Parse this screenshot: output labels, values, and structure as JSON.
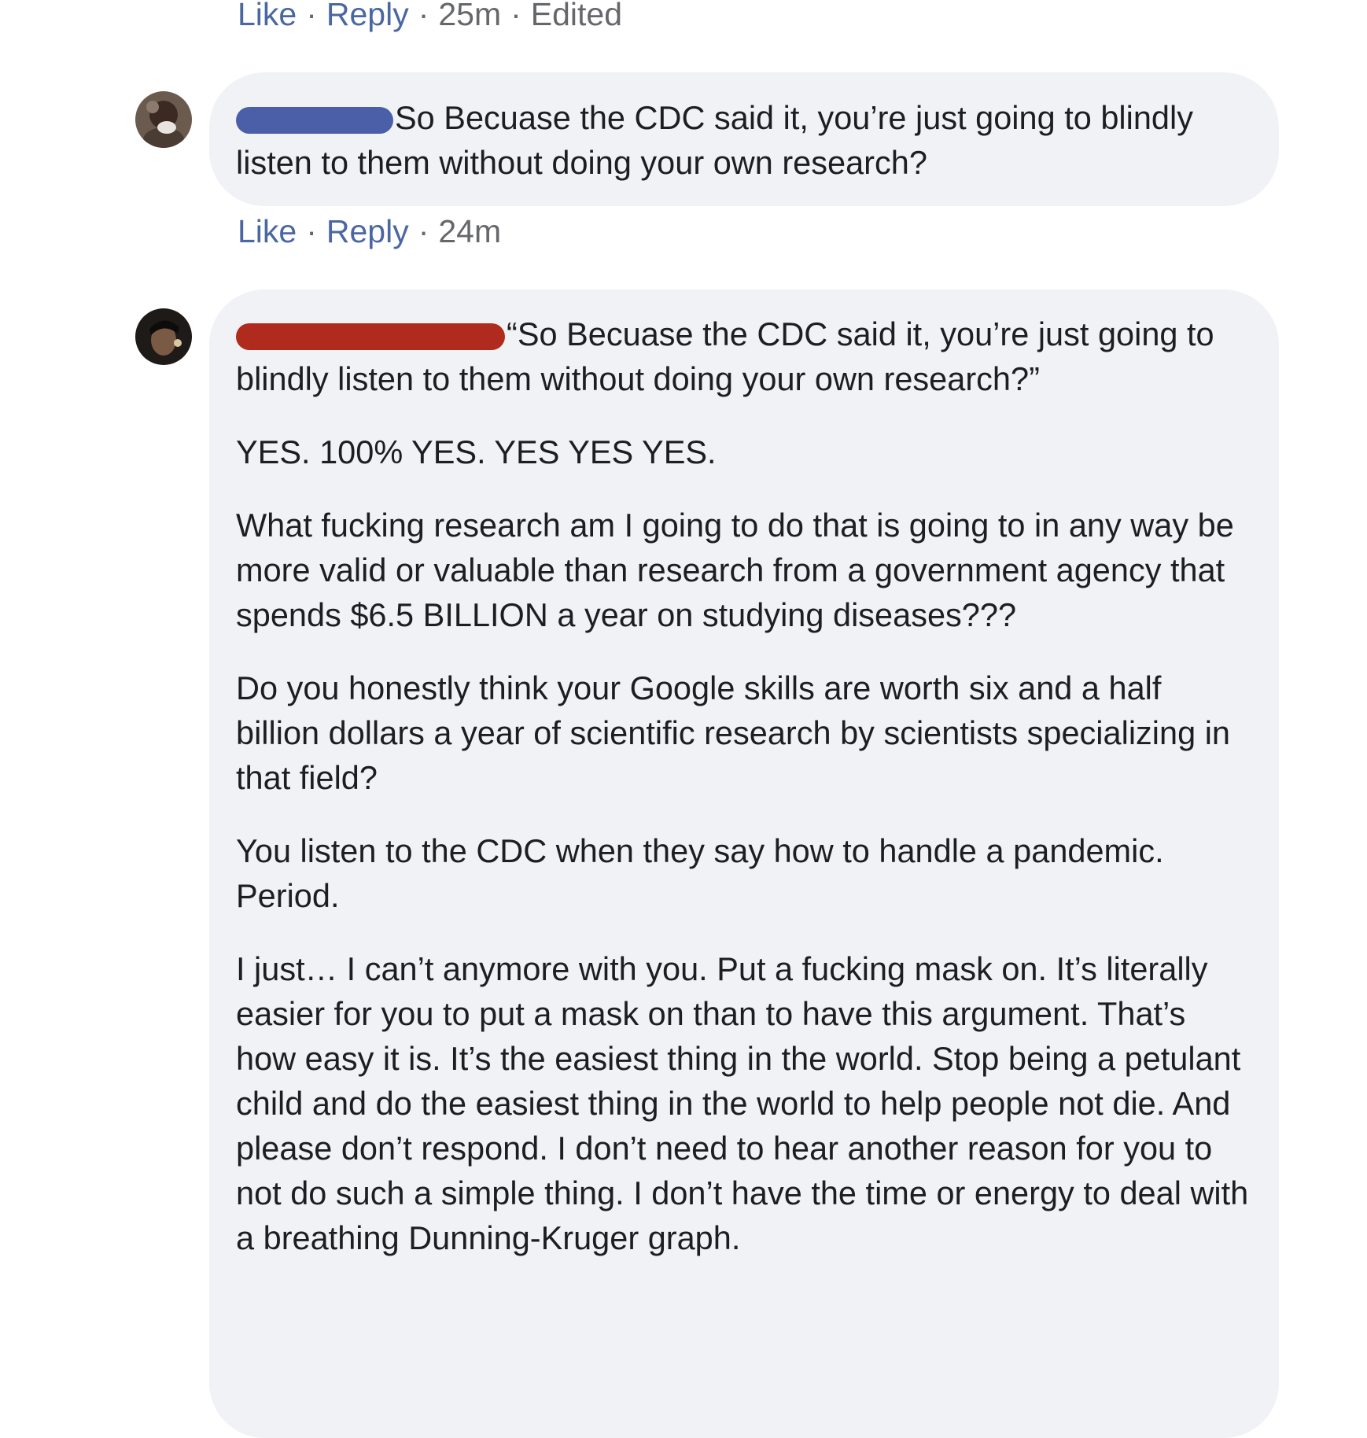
{
  "comments": [
    {
      "actions": {
        "like": "Like",
        "reply": "Reply",
        "time": "25m",
        "edited": "Edited"
      }
    },
    {
      "redaction_color": "#4a5fa8",
      "text": "So Becuase the CDC said it, you’re just going to blindly listen to them without doing your own research?",
      "actions": {
        "like": "Like",
        "reply": "Reply",
        "time": "24m"
      }
    },
    {
      "redaction_color": "#b02a1e",
      "paragraphs": [
        "“So Becuase the CDC said it, you’re just going to blindly listen to them without doing your own research?”",
        "YES. 100% YES. YES YES YES.",
        "What fucking research am I going to do that is going to in any way be more valid or valuable than research from a government agency that spends $6.5 BILLION a year on studying diseases???",
        "Do you honestly think your Google skills are worth six and a half billion dollars a year of scientific research by scientists specializing in that field?",
        "You listen to the CDC when they say how to handle a pandemic. Period.",
        "I just… I can’t anymore with you. Put a fucking mask on. It’s literally easier for you to put a mask on than to have this argument. That’s how easy it is. It’s the easiest thing in the world. Stop being a petulant child and do the easiest thing in the world to help people not die. And please don’t respond. I don’t need to hear another reason for you to not do such a simple thing. I don’t have the time or energy to deal with a breathing Dunning-Kruger graph."
      ]
    }
  ],
  "separator": "·"
}
